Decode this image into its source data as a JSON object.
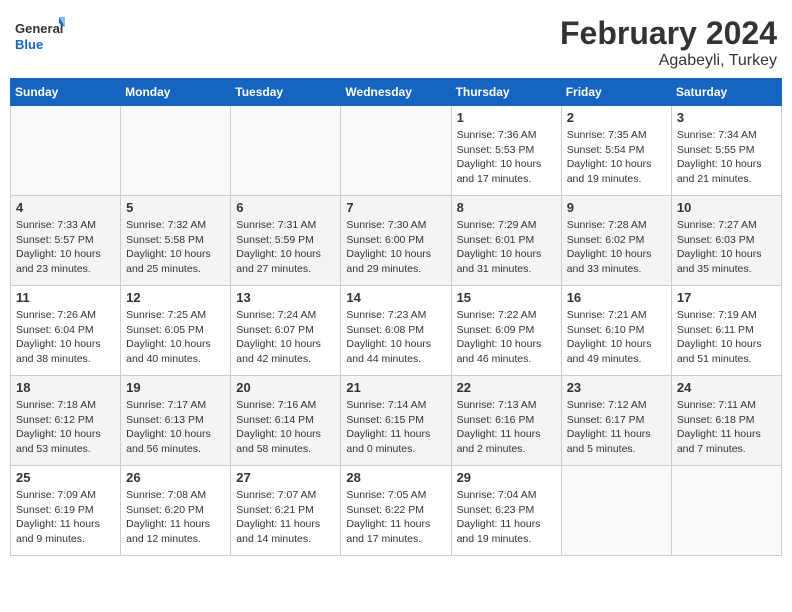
{
  "logo": {
    "line1": "General",
    "line2": "Blue"
  },
  "title": "February 2024",
  "subtitle": "Agabeyli, Turkey",
  "days_of_week": [
    "Sunday",
    "Monday",
    "Tuesday",
    "Wednesday",
    "Thursday",
    "Friday",
    "Saturday"
  ],
  "weeks": [
    [
      {
        "day": "",
        "info": "",
        "empty": true
      },
      {
        "day": "",
        "info": "",
        "empty": true
      },
      {
        "day": "",
        "info": "",
        "empty": true
      },
      {
        "day": "",
        "info": "",
        "empty": true
      },
      {
        "day": "1",
        "info": "Sunrise: 7:36 AM\nSunset: 5:53 PM\nDaylight: 10 hours\nand 17 minutes."
      },
      {
        "day": "2",
        "info": "Sunrise: 7:35 AM\nSunset: 5:54 PM\nDaylight: 10 hours\nand 19 minutes."
      },
      {
        "day": "3",
        "info": "Sunrise: 7:34 AM\nSunset: 5:55 PM\nDaylight: 10 hours\nand 21 minutes."
      }
    ],
    [
      {
        "day": "4",
        "info": "Sunrise: 7:33 AM\nSunset: 5:57 PM\nDaylight: 10 hours\nand 23 minutes."
      },
      {
        "day": "5",
        "info": "Sunrise: 7:32 AM\nSunset: 5:58 PM\nDaylight: 10 hours\nand 25 minutes."
      },
      {
        "day": "6",
        "info": "Sunrise: 7:31 AM\nSunset: 5:59 PM\nDaylight: 10 hours\nand 27 minutes."
      },
      {
        "day": "7",
        "info": "Sunrise: 7:30 AM\nSunset: 6:00 PM\nDaylight: 10 hours\nand 29 minutes."
      },
      {
        "day": "8",
        "info": "Sunrise: 7:29 AM\nSunset: 6:01 PM\nDaylight: 10 hours\nand 31 minutes."
      },
      {
        "day": "9",
        "info": "Sunrise: 7:28 AM\nSunset: 6:02 PM\nDaylight: 10 hours\nand 33 minutes."
      },
      {
        "day": "10",
        "info": "Sunrise: 7:27 AM\nSunset: 6:03 PM\nDaylight: 10 hours\nand 35 minutes."
      }
    ],
    [
      {
        "day": "11",
        "info": "Sunrise: 7:26 AM\nSunset: 6:04 PM\nDaylight: 10 hours\nand 38 minutes."
      },
      {
        "day": "12",
        "info": "Sunrise: 7:25 AM\nSunset: 6:05 PM\nDaylight: 10 hours\nand 40 minutes."
      },
      {
        "day": "13",
        "info": "Sunrise: 7:24 AM\nSunset: 6:07 PM\nDaylight: 10 hours\nand 42 minutes."
      },
      {
        "day": "14",
        "info": "Sunrise: 7:23 AM\nSunset: 6:08 PM\nDaylight: 10 hours\nand 44 minutes."
      },
      {
        "day": "15",
        "info": "Sunrise: 7:22 AM\nSunset: 6:09 PM\nDaylight: 10 hours\nand 46 minutes."
      },
      {
        "day": "16",
        "info": "Sunrise: 7:21 AM\nSunset: 6:10 PM\nDaylight: 10 hours\nand 49 minutes."
      },
      {
        "day": "17",
        "info": "Sunrise: 7:19 AM\nSunset: 6:11 PM\nDaylight: 10 hours\nand 51 minutes."
      }
    ],
    [
      {
        "day": "18",
        "info": "Sunrise: 7:18 AM\nSunset: 6:12 PM\nDaylight: 10 hours\nand 53 minutes."
      },
      {
        "day": "19",
        "info": "Sunrise: 7:17 AM\nSunset: 6:13 PM\nDaylight: 10 hours\nand 56 minutes."
      },
      {
        "day": "20",
        "info": "Sunrise: 7:16 AM\nSunset: 6:14 PM\nDaylight: 10 hours\nand 58 minutes."
      },
      {
        "day": "21",
        "info": "Sunrise: 7:14 AM\nSunset: 6:15 PM\nDaylight: 11 hours\nand 0 minutes."
      },
      {
        "day": "22",
        "info": "Sunrise: 7:13 AM\nSunset: 6:16 PM\nDaylight: 11 hours\nand 2 minutes."
      },
      {
        "day": "23",
        "info": "Sunrise: 7:12 AM\nSunset: 6:17 PM\nDaylight: 11 hours\nand 5 minutes."
      },
      {
        "day": "24",
        "info": "Sunrise: 7:11 AM\nSunset: 6:18 PM\nDaylight: 11 hours\nand 7 minutes."
      }
    ],
    [
      {
        "day": "25",
        "info": "Sunrise: 7:09 AM\nSunset: 6:19 PM\nDaylight: 11 hours\nand 9 minutes."
      },
      {
        "day": "26",
        "info": "Sunrise: 7:08 AM\nSunset: 6:20 PM\nDaylight: 11 hours\nand 12 minutes."
      },
      {
        "day": "27",
        "info": "Sunrise: 7:07 AM\nSunset: 6:21 PM\nDaylight: 11 hours\nand 14 minutes."
      },
      {
        "day": "28",
        "info": "Sunrise: 7:05 AM\nSunset: 6:22 PM\nDaylight: 11 hours\nand 17 minutes."
      },
      {
        "day": "29",
        "info": "Sunrise: 7:04 AM\nSunset: 6:23 PM\nDaylight: 11 hours\nand 19 minutes."
      },
      {
        "day": "",
        "info": "",
        "empty": true
      },
      {
        "day": "",
        "info": "",
        "empty": true
      }
    ]
  ]
}
